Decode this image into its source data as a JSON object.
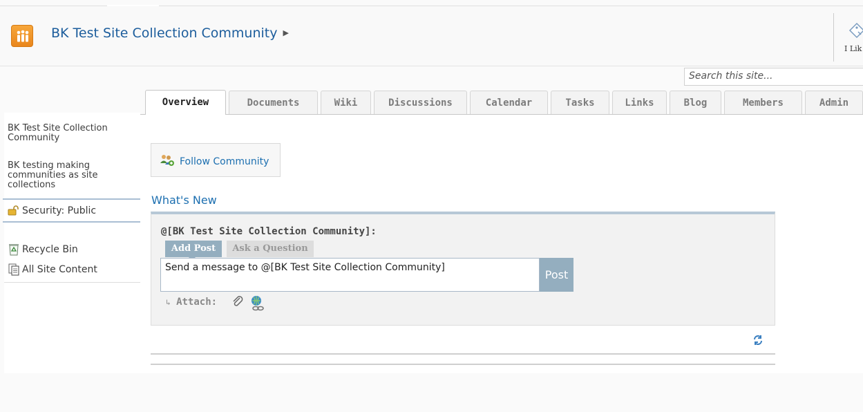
{
  "header": {
    "site_title": "BK Test Site Collection Community",
    "ilike_label": "I Lik"
  },
  "search": {
    "placeholder": "Search this site..."
  },
  "tabs": [
    {
      "label": "Overview",
      "active": true
    },
    {
      "label": "Documents",
      "active": false
    },
    {
      "label": "Wiki",
      "active": false
    },
    {
      "label": "Discussions",
      "active": false
    },
    {
      "label": "Calendar",
      "active": false
    },
    {
      "label": "Tasks",
      "active": false
    },
    {
      "label": "Links",
      "active": false
    },
    {
      "label": "Blog",
      "active": false
    },
    {
      "label": "Members",
      "active": false
    },
    {
      "label": "Admin",
      "active": false
    }
  ],
  "sidebar": {
    "community_name": "BK Test Site Collection Community",
    "description": "BK testing making communities as site collections",
    "security": "Security: Public",
    "links": [
      {
        "label": "Recycle Bin",
        "icon": "recycle-bin-icon"
      },
      {
        "label": "All Site Content",
        "icon": "site-content-icon"
      }
    ]
  },
  "main": {
    "follow_label": "Follow Community",
    "whats_new": "What's New",
    "mention": "@[BK Test Site Collection Community]:",
    "mode_tabs": [
      {
        "label": "Add Post",
        "active": true
      },
      {
        "label": "Ask a Question",
        "active": false
      }
    ],
    "message_value": "Send a message to @[BK Test Site Collection Community]",
    "post_label": "Post",
    "attach_label": "Attach:"
  },
  "colors": {
    "link_blue": "#1c6fb0",
    "post_accent": "#94aebf",
    "logo_orange": "#f29b2f"
  }
}
